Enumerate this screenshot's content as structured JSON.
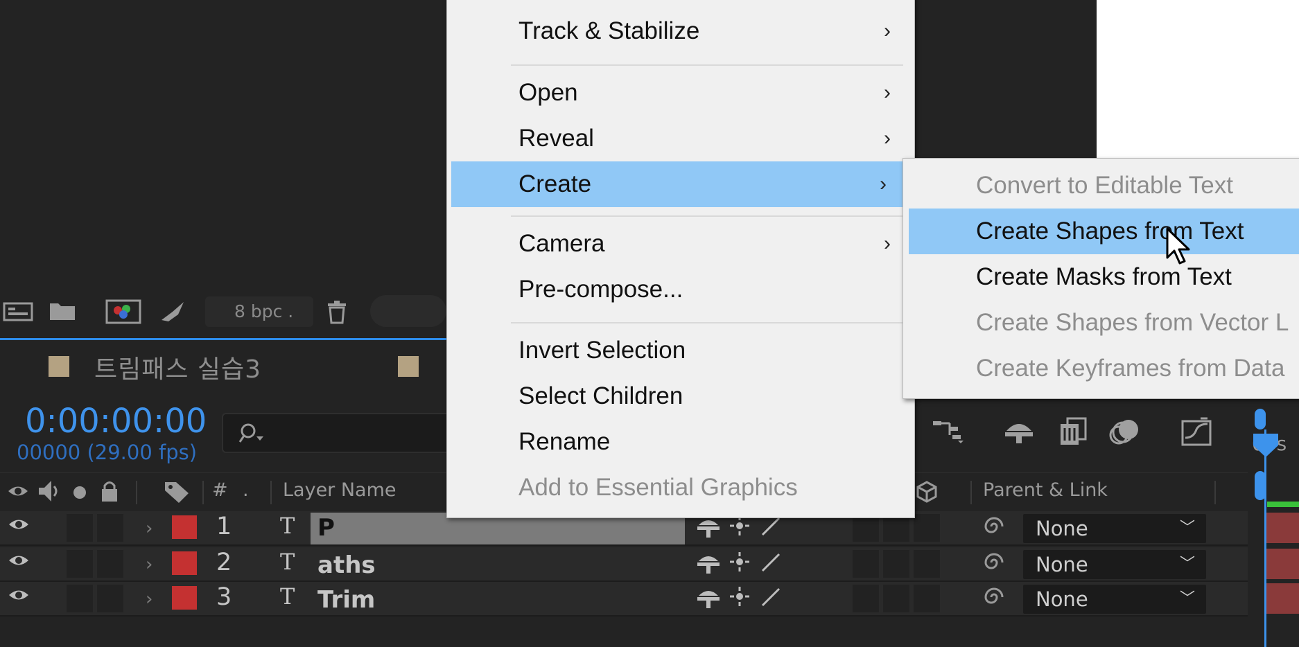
{
  "project_toolbar": {
    "bit_depth": "8 bpc",
    "icons": [
      "interpret-footage-icon",
      "new-folder-icon",
      "new-composition-icon",
      "render-queue-icon",
      "trash-icon"
    ]
  },
  "composition": {
    "tab_name": "트림패스 실습3"
  },
  "timeline": {
    "timecode": "0:00:00:00",
    "frame_info": "00000 (29.00 fps)",
    "search_icon": "search-icon",
    "ruler_label": "00s",
    "columns": {
      "hash": "#",
      "layer_name": "Layer Name",
      "parent_link": "Parent & Link"
    },
    "layers": [
      {
        "index": "1",
        "type_icon": "T",
        "name": "P",
        "parent": "None"
      },
      {
        "index": "2",
        "type_icon": "T",
        "name": "aths",
        "parent": "None"
      },
      {
        "index": "3",
        "type_icon": "T",
        "name": "Trim",
        "parent": "None"
      }
    ]
  },
  "context_menu": {
    "items": [
      {
        "label": "Track & Stabilize",
        "submenu": true
      },
      {
        "label": "Open",
        "submenu": true
      },
      {
        "label": "Reveal",
        "submenu": true
      },
      {
        "label": "Create",
        "submenu": true,
        "highlighted": true
      },
      {
        "label": "Camera",
        "submenu": true
      },
      {
        "label": "Pre-compose...",
        "submenu": false
      },
      {
        "label": "Invert Selection",
        "submenu": false
      },
      {
        "label": "Select Children",
        "submenu": false
      },
      {
        "label": "Rename",
        "submenu": false
      },
      {
        "label": "Add to Essential Graphics",
        "submenu": false,
        "disabled": true
      }
    ],
    "arrow": "›"
  },
  "create_submenu": {
    "items": [
      {
        "label": "Convert to Editable Text",
        "disabled": true
      },
      {
        "label": "Create Shapes from Text",
        "highlighted": true
      },
      {
        "label": "Create Masks from Text"
      },
      {
        "label": "Create Shapes from Vector L",
        "disabled": true
      },
      {
        "label": "Create Keyframes from Data",
        "disabled": true
      }
    ]
  },
  "colors": {
    "accent": "#3f93ec",
    "menu_highlight": "#90c8f6",
    "label_red": "#c43131",
    "comp_swatch": "#b4a282"
  }
}
